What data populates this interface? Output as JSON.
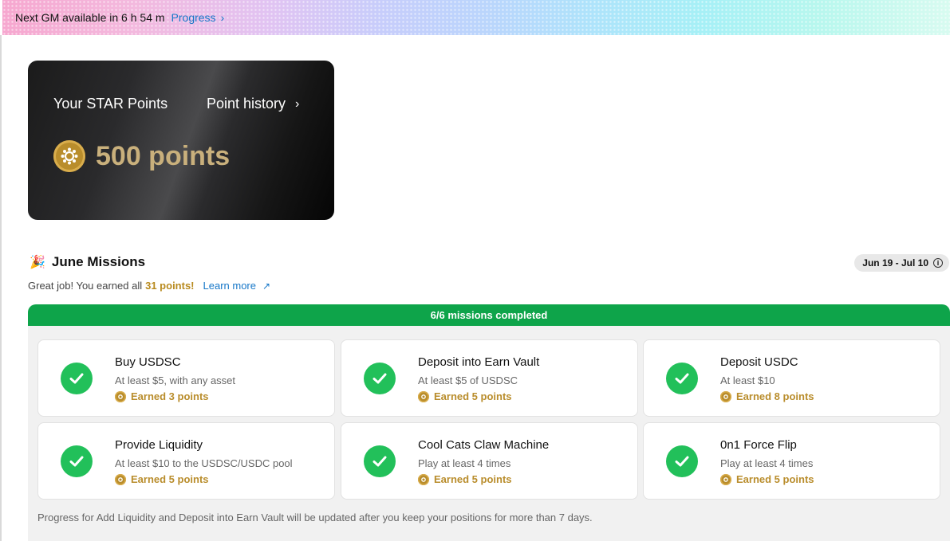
{
  "banner": {
    "gm_text": "Next GM available in 6 h 54 m",
    "progress_label": "Progress"
  },
  "points_card": {
    "label": "Your STAR Points",
    "history_label": "Point history",
    "amount": "500 points"
  },
  "missions": {
    "title": "June Missions",
    "date_range": "Jun 19 - Jul 10",
    "earned_prefix": "Great job! You earned all",
    "earned_points": "31 points!",
    "learn_more": "Learn more",
    "progress_text": "6/6 missions completed",
    "items": [
      {
        "title": "Buy USDSC",
        "desc": "At least $5, with any asset",
        "earned": "Earned 3 points"
      },
      {
        "title": "Deposit into Earn Vault",
        "desc": "At least $5 of USDSC",
        "earned": "Earned 5 points"
      },
      {
        "title": "Deposit USDC",
        "desc": "At least $10",
        "earned": "Earned 8 points"
      },
      {
        "title": "Provide Liquidity",
        "desc": "At least $10 to the USDSC/USDC pool",
        "earned": "Earned 5 points"
      },
      {
        "title": "Cool Cats Claw Machine",
        "desc": "Play at least 4 times",
        "earned": "Earned 5 points"
      },
      {
        "title": "0n1 Force Flip",
        "desc": "Play at least 4 times",
        "earned": "Earned 5 points"
      }
    ],
    "footnote": "Progress for Add Liquidity and Deposit into Earn Vault will be updated after you keep your positions for more than 7 days."
  },
  "colors": {
    "accent_gold": "#b98d2c",
    "success_green": "#22c05a",
    "progress_bar_green": "#0ea44a",
    "link_blue": "#1677c8"
  },
  "icons": [
    "chevron-right-icon",
    "star-coin-icon",
    "party-popper-icon",
    "info-icon",
    "arrow-up-right-icon",
    "checkmark-icon"
  ]
}
